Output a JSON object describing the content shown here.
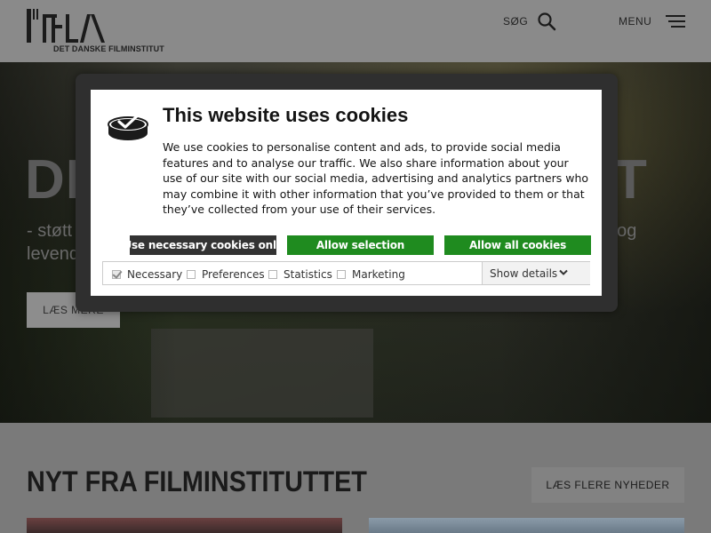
{
  "header": {
    "logo_text": "DET DANSKE FILMINSTITUT",
    "search_label": "SØG",
    "menu_label": "MENU"
  },
  "hero": {
    "heading_start": "DE",
    "heading_end": "T",
    "subline1_start": "- støtt",
    "subline1_end": "t og",
    "subline2": "levende",
    "read_more_label": "LÆS MERE"
  },
  "news": {
    "title": "NYT FRA FILMINSTITUTTET",
    "more_label": "LÆS FLERE NYHEDER"
  },
  "cookie_dialog": {
    "title": "This website uses cookies",
    "body": "We use cookies to personalise content and ads, to provide social media features and to analyse our traffic. We also share information about your use of our site with our social media, advertising and analytics partners who may combine it with other information that you’ve provided to them or that they’ve collected from your use of their services.",
    "buttons": {
      "necessary": "Use necessary cookies only",
      "selection": "Allow selection",
      "all": "Allow all cookies"
    },
    "options": [
      {
        "label": "Necessary",
        "checked": true
      },
      {
        "label": "Preferences",
        "checked": false
      },
      {
        "label": "Statistics",
        "checked": false
      },
      {
        "label": "Marketing",
        "checked": false
      }
    ],
    "details_label": "Show details"
  },
  "colors": {
    "accept_green": "#1f8b1f",
    "dark_button": "#333333"
  }
}
